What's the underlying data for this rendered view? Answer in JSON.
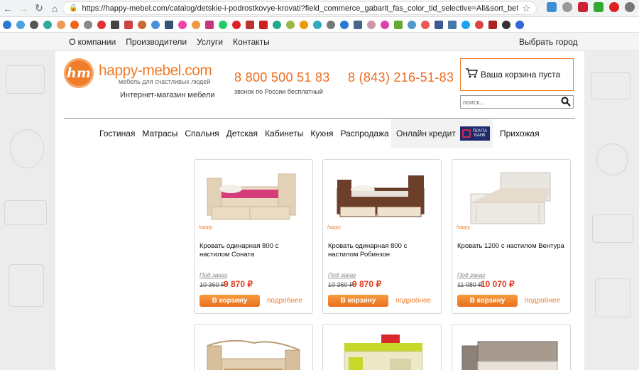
{
  "browser": {
    "url": "https://happy-mebel.com/catalog/detskie-i-podrostkovye-krovati?field_commerce_gabarit_fas_color_tid_selective=All&sort_bef_combine=com..."
  },
  "topnav": {
    "links": [
      "О компании",
      "Производители",
      "Услуги",
      "Контакты"
    ],
    "city": "Выбрать город"
  },
  "header": {
    "logo_mark": "hm",
    "logo_text": "happy-mebel.com",
    "logo_sub": "мебель для счастливых людей",
    "shop_label": "Интернет-магазин мебели",
    "phone1": "8 800 500 51 83",
    "phone1_note": "звонок по России бесплатный",
    "phone2": "8 (843) 216-51-83",
    "cart": "Ваша корзина пуста",
    "search_placeholder": "поиск..."
  },
  "menu": {
    "items": [
      "Гостиная",
      "Матрасы",
      "Спальня",
      "Детская",
      "Кабинеты",
      "Кухня",
      "Распродажа"
    ],
    "credit": "Онлайн кредит",
    "bank_label": "ПОЧТА БАНК",
    "last": "Прихожая"
  },
  "products": [
    {
      "title": "Кровать одинарная 800 с настилом Соната",
      "order": "Под заказ",
      "old_price": "10 360 ₽",
      "new_price": "9 870 ₽",
      "buy": "В корзину",
      "more": "подробнее",
      "brand": "happy"
    },
    {
      "title": "Кровать одинарная 800 с настилом Робинзон",
      "order": "Под заказ",
      "old_price": "10 360 ₽",
      "new_price": "9 870 ₽",
      "buy": "В корзину",
      "more": "подробнее",
      "brand": "happy"
    },
    {
      "title": "Кровать 1200 с настилом Вентура",
      "order": "Под заказ",
      "old_price": "11 080 ₽",
      "new_price": "10 070 ₽",
      "buy": "В корзину",
      "more": "подробнее",
      "brand": "happy"
    }
  ],
  "colors": {
    "accent": "#ef7d2a",
    "price": "#e03a1c"
  }
}
